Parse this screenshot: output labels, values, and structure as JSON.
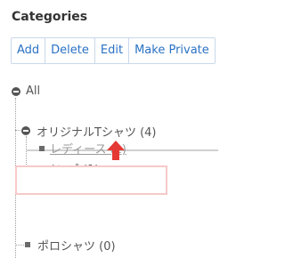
{
  "panel": {
    "title": "Categories"
  },
  "toolbar": {
    "buttons": [
      "Add",
      "Delete",
      "Edit",
      "Make Private"
    ]
  },
  "tree": {
    "root": {
      "label": "All"
    },
    "group": {
      "label": "オリジナルTシャツ (4)"
    },
    "children": [
      {
        "label": "レディース (1)",
        "state": "dragging"
      },
      {
        "label": "メンズ (1)"
      }
    ],
    "sibling": {
      "label": "ポロシャツ (0)"
    }
  },
  "colors": {
    "accent": "#2a72c4",
    "drop_target_border": "#f6c9c9",
    "arrow": "#e53935"
  },
  "icons": {
    "expanded": "minus-circle-icon",
    "leaf": "square-bullet-icon",
    "drag_direction": "arrow-up-icon"
  }
}
